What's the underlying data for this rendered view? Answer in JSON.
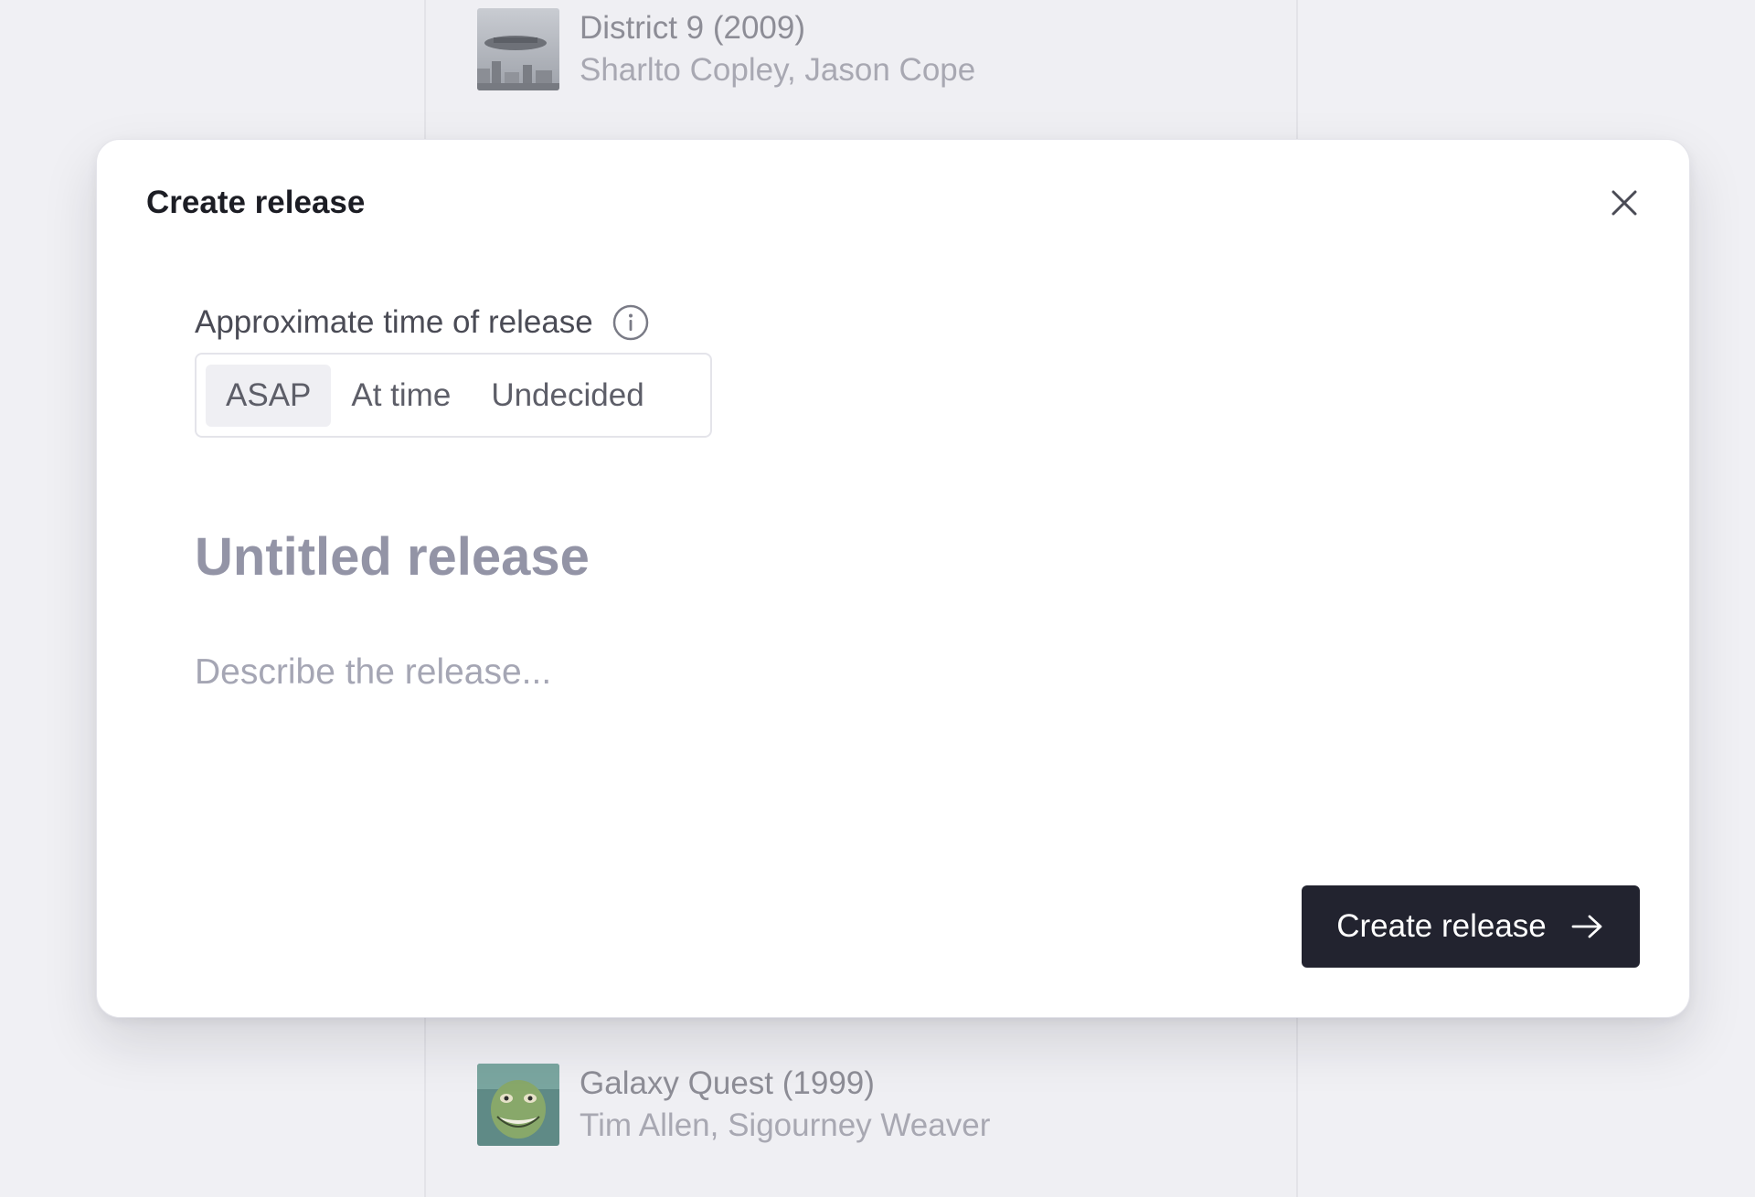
{
  "background_list": {
    "items": [
      {
        "title": "District 9 (2009)",
        "subtitle": "Sharlto Copley, Jason Cope",
        "thumbnail": "district-9-poster"
      },
      {
        "title": "Galaxy Quest (1999)",
        "subtitle": "Tim Allen, Sigourney Weaver",
        "thumbnail": "galaxy-quest-poster"
      }
    ]
  },
  "modal": {
    "title": "Create release",
    "close_icon": "close-icon",
    "release_time": {
      "label": "Approximate time of release",
      "info_icon": "info-icon",
      "options": [
        "ASAP",
        "At time",
        "Undecided"
      ],
      "selected": "ASAP"
    },
    "name_field": {
      "placeholder": "Untitled release",
      "value": ""
    },
    "description_field": {
      "placeholder": "Describe the release...",
      "value": ""
    },
    "submit": {
      "label": "Create release",
      "icon": "arrow-right-icon"
    }
  },
  "colors": {
    "primary_button": "#22232f",
    "background": "#f0f0f4"
  }
}
